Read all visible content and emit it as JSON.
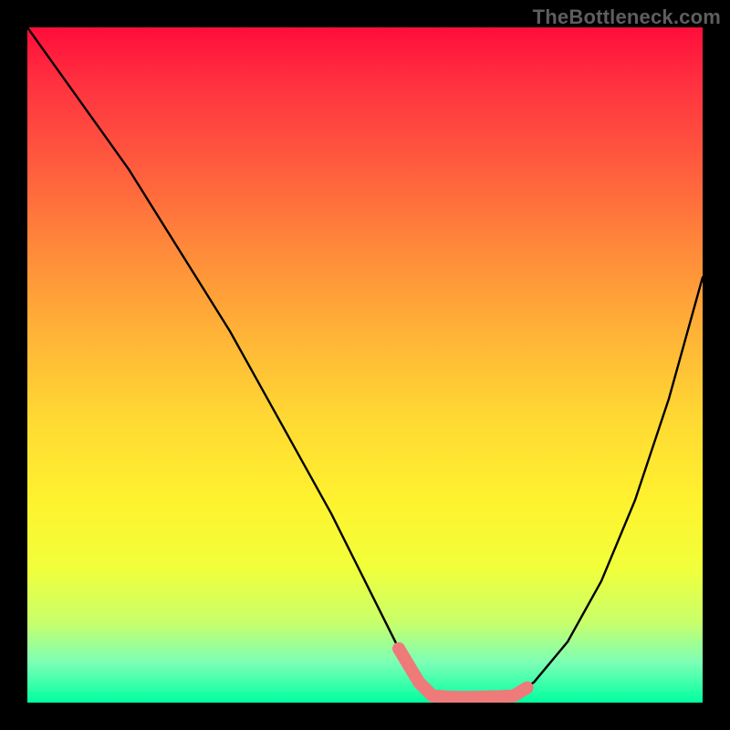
{
  "watermark": "TheBottleneck.com",
  "chart_data": {
    "type": "line",
    "title": "",
    "xlabel": "",
    "ylabel": "",
    "xlim": [
      0,
      100
    ],
    "ylim": [
      0,
      100
    ],
    "series": [
      {
        "name": "curve",
        "color": "#000000",
        "x": [
          0,
          5,
          10,
          15,
          20,
          25,
          30,
          35,
          40,
          45,
          50,
          55,
          58,
          60,
          63,
          66,
          70,
          72,
          75,
          80,
          85,
          90,
          95,
          100
        ],
        "values": [
          100,
          93,
          86,
          79,
          71,
          63,
          55,
          46,
          37,
          28,
          18,
          8,
          3,
          1,
          0.5,
          0.5,
          0.6,
          1,
          3,
          9,
          18,
          30,
          45,
          63
        ]
      },
      {
        "name": "highlight",
        "color": "#ee7a7a",
        "x": [
          55,
          58,
          60,
          63,
          66,
          70,
          72,
          74
        ],
        "values": [
          8,
          3,
          1,
          0.8,
          0.8,
          0.9,
          1,
          2.2
        ]
      }
    ]
  }
}
